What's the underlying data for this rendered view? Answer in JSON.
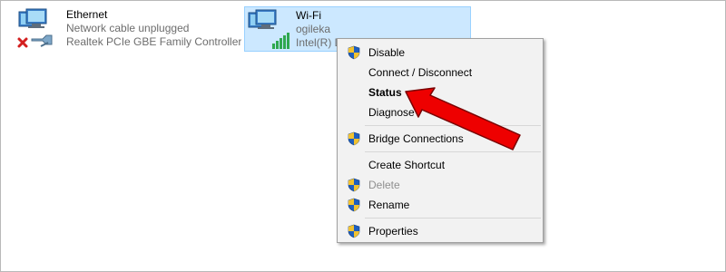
{
  "adapters": [
    {
      "name": "Ethernet",
      "status": "Network cable unplugged",
      "device": "Realtek PCIe GBE Family Controller",
      "icon": "ethernet-disconnected-icon"
    },
    {
      "name": "Wi-Fi",
      "status": "ogileka",
      "device": "Intel(R) D",
      "icon": "wifi-adapter-icon"
    }
  ],
  "context_menu": {
    "items": [
      {
        "label": "Disable",
        "shield": true,
        "bold": false,
        "disabled": false
      },
      {
        "label": "Connect / Disconnect",
        "shield": false,
        "bold": false,
        "disabled": false
      },
      {
        "label": "Status",
        "shield": false,
        "bold": true,
        "disabled": false
      },
      {
        "label": "Diagnose",
        "shield": false,
        "bold": false,
        "disabled": false
      },
      {
        "label": "Bridge Connections",
        "shield": true,
        "bold": false,
        "disabled": false
      },
      {
        "label": "Create Shortcut",
        "shield": false,
        "bold": false,
        "disabled": false
      },
      {
        "label": "Delete",
        "shield": true,
        "bold": false,
        "disabled": true
      },
      {
        "label": "Rename",
        "shield": true,
        "bold": false,
        "disabled": false
      },
      {
        "label": "Properties",
        "shield": true,
        "bold": false,
        "disabled": false
      }
    ]
  },
  "colors": {
    "selection_bg": "#cce8ff",
    "selection_border": "#99d1ff",
    "menu_bg": "#f2f2f2",
    "annotation_arrow": "#ee0000"
  }
}
